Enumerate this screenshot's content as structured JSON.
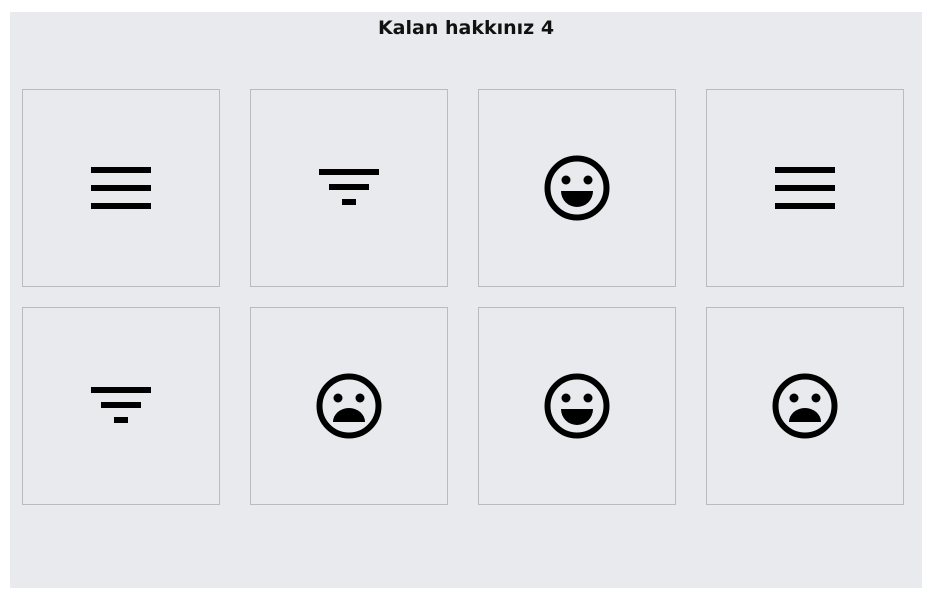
{
  "game": {
    "title": "Kalan hakkınız 4"
  },
  "cards": [
    {
      "icon": "menu-icon"
    },
    {
      "icon": "filter-icon"
    },
    {
      "icon": "happy-face-icon"
    },
    {
      "icon": "menu-icon"
    },
    {
      "icon": "filter-icon"
    },
    {
      "icon": "sad-face-icon"
    },
    {
      "icon": "happy-face-icon"
    },
    {
      "icon": "sad-face-icon"
    }
  ],
  "colors": {
    "background": "#e8eaed",
    "icon": "#000000",
    "border": "#b9bbbe"
  }
}
